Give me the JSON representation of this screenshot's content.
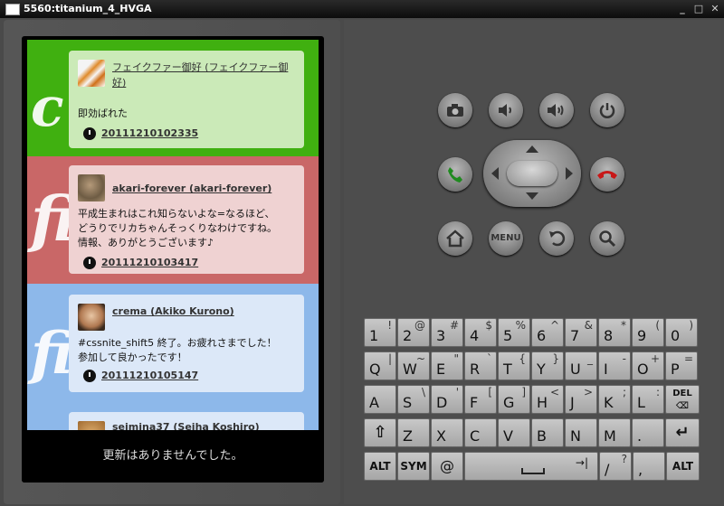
{
  "window": {
    "title": "5560:titanium_4_HVGA"
  },
  "timeline": {
    "tweets": [
      {
        "user": "フェイクファー御好 (フェイクファー御好)",
        "text": "即効ばれた",
        "time": "20111210102335"
      },
      {
        "user": "akari-forever (akari-forever)",
        "text": "平成生まれはこれ知らないよな=なるほど、\nどうりでリカちゃんそっくりなわけですね。\n情報、ありがとうございます♪",
        "time": "20111210103417"
      },
      {
        "user": "crema (Akiko Kurono)",
        "text": "#cssnite_shift5 終了。お疲れさまでした！\n参加して良かったです！",
        "time": "20111210105147"
      },
      {
        "user": "seimina37 (Seiha Koshiro)"
      }
    ],
    "status": "更新はありませんでした。"
  },
  "controls": {
    "menu_label": "MENU"
  },
  "keyboard": {
    "row1": [
      {
        "m": "1",
        "a": "!"
      },
      {
        "m": "2",
        "a": "@"
      },
      {
        "m": "3",
        "a": "#"
      },
      {
        "m": "4",
        "a": "$"
      },
      {
        "m": "5",
        "a": "%"
      },
      {
        "m": "6",
        "a": "^"
      },
      {
        "m": "7",
        "a": "&"
      },
      {
        "m": "8",
        "a": "*"
      },
      {
        "m": "9",
        "a": "("
      },
      {
        "m": "0",
        "a": ")"
      }
    ],
    "row2": [
      {
        "m": "Q",
        "a": "|"
      },
      {
        "m": "W",
        "a": "~"
      },
      {
        "m": "E",
        "a": "\""
      },
      {
        "m": "R",
        "a": "`"
      },
      {
        "m": "T",
        "a": "{"
      },
      {
        "m": "Y",
        "a": "}"
      },
      {
        "m": "U",
        "a": "_"
      },
      {
        "m": "I",
        "a": "-"
      },
      {
        "m": "O",
        "a": "+"
      },
      {
        "m": "P",
        "a": "="
      }
    ],
    "row3": [
      {
        "m": "A",
        "a": ""
      },
      {
        "m": "S",
        "a": "\\"
      },
      {
        "m": "D",
        "a": "'"
      },
      {
        "m": "F",
        "a": "["
      },
      {
        "m": "G",
        "a": "]"
      },
      {
        "m": "H",
        "a": "<"
      },
      {
        "m": "J",
        "a": ">"
      },
      {
        "m": "K",
        "a": ";"
      },
      {
        "m": "L",
        "a": ":"
      }
    ],
    "del_label": "DEL",
    "row4": [
      "Z",
      "X",
      "C",
      "V",
      "B",
      "N",
      "M",
      "."
    ],
    "alt_label": "ALT",
    "sym_label": "SYM",
    "at_label": "@",
    "slash": {
      "m": "/",
      "a": "?"
    },
    "comma": ","
  }
}
